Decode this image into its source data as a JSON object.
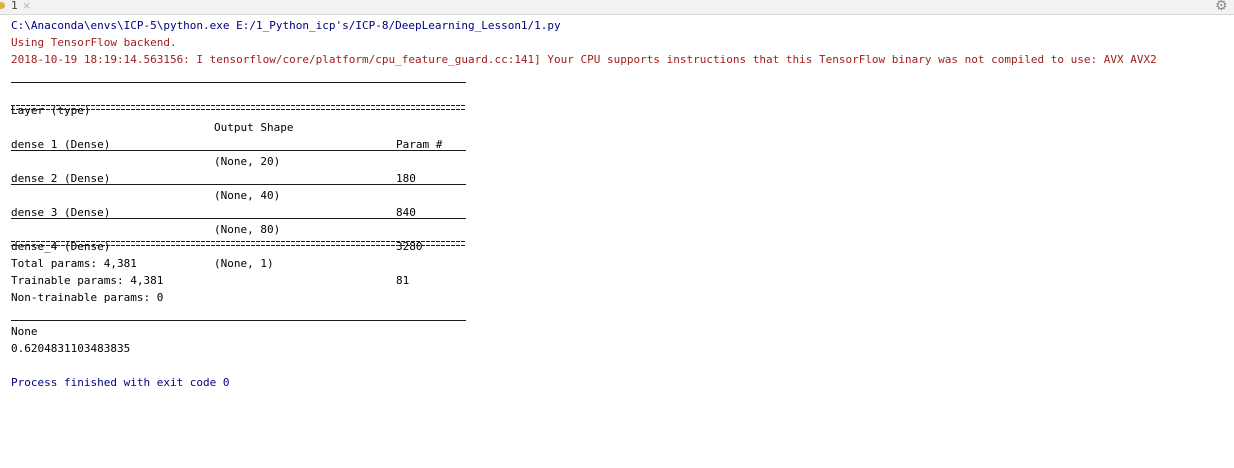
{
  "tab": {
    "number": "1",
    "close_glyph": "×"
  },
  "toolbar": {
    "settings_icon": "gear-icon",
    "settings_glyph": "⚙"
  },
  "colors": {
    "path": "#000080",
    "stderr": "#a01e1e",
    "stdout": "#000000"
  },
  "console": {
    "command": "C:\\Anaconda\\envs\\ICP-5\\python.exe E:/1_Python_icp's/ICP-8/DeepLearning_Lesson1/1.py",
    "backend": "Using TensorFlow backend.",
    "warning": "2018-10-19 18:19:14.563156: I tensorflow/core/platform/cpu_feature_guard.cc:141] Your CPU supports instructions that this TensorFlow binary was not compiled to use: AVX AVX2",
    "summary": {
      "headers": [
        "Layer (type)",
        "Output Shape",
        "Param #"
      ],
      "rows": [
        [
          "dense_1 (Dense)",
          "(None, 20)",
          "180"
        ],
        [
          "dense_2 (Dense)",
          "(None, 40)",
          "840"
        ],
        [
          "dense_3 (Dense)",
          "(None, 80)",
          "3280"
        ],
        [
          "dense_4 (Dense)",
          "(None, 1)",
          "81"
        ]
      ],
      "total": "Total params: 4,381",
      "trainable": "Trainable params: 4,381",
      "non_trainable": "Non-trainable params: 0"
    },
    "none_output": "None",
    "score_output": "0.6204831103483835",
    "exit_message": "Process finished with exit code 0"
  }
}
